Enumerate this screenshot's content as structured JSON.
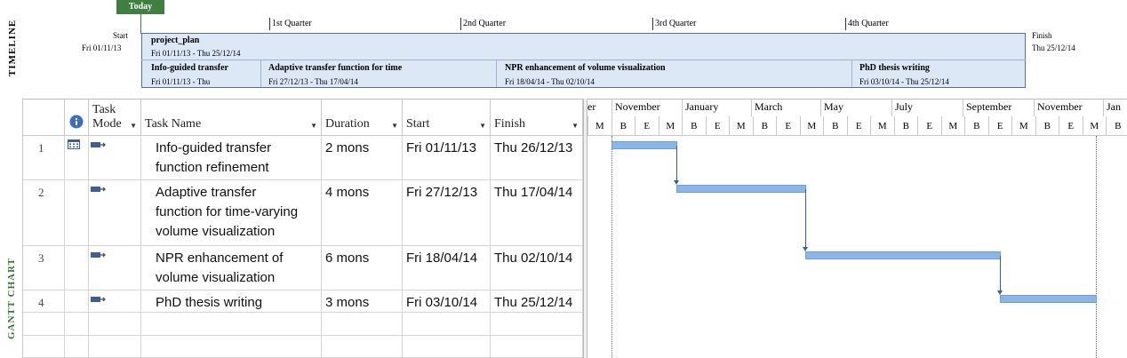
{
  "timeline": {
    "label": "TIMELINE",
    "today": "Today",
    "start_label": "Start",
    "start_date": "Fri 01/11/13",
    "finish_label": "Finish",
    "finish_date": "Thu 25/12/14",
    "quarters": [
      "1st Quarter",
      "2nd Quarter",
      "3rd Quarter",
      "4th Quarter"
    ],
    "summary": {
      "name": "project_plan",
      "dates": "Fri 01/11/13 - Thu 25/12/14"
    },
    "segments": [
      {
        "name": "Info-guided transfer",
        "dates": "Fri 01/11/13 - Thu"
      },
      {
        "name": "Adaptive transfer function for time",
        "dates": "Fri 27/12/13 - Thu 17/04/14"
      },
      {
        "name": "NPR enhancement of volume visualization",
        "dates": "Fri 18/04/14 - Thu 02/10/14"
      },
      {
        "name": "PhD thesis writing",
        "dates": "Fri 03/10/14 - Thu 25/12/14"
      }
    ]
  },
  "gantt": {
    "label": "GANTT CHART",
    "info_icon": "info-icon",
    "columns": {
      "mode_line1": "Task",
      "mode_line2": "Mode",
      "name": "Task Name",
      "duration": "Duration",
      "start": "Start",
      "finish": "Finish"
    },
    "tasks": [
      {
        "id": "1",
        "name_lines": [
          "Info-guided transfer",
          "function refinement"
        ],
        "duration": "2 mons",
        "start": "Fri 01/11/13",
        "finish": "Thu 26/12/13"
      },
      {
        "id": "2",
        "name_lines": [
          "Adaptive transfer",
          "function for time-varying",
          "volume visualization"
        ],
        "duration": "4 mons",
        "start": "Fri 27/12/13",
        "finish": "Thu 17/04/14"
      },
      {
        "id": "3",
        "name_lines": [
          "NPR enhancement of",
          "volume visualization"
        ],
        "duration": "6 mons",
        "start": "Fri 18/04/14",
        "finish": "Thu 02/10/14"
      },
      {
        "id": "4",
        "name_lines": [
          "PhD thesis writing"
        ],
        "duration": "3 mons",
        "start": "Fri 03/10/14",
        "finish": "Thu 25/12/14"
      }
    ],
    "months": [
      "er",
      "November",
      "January",
      "March",
      "May",
      "July",
      "September",
      "November",
      "Jan"
    ],
    "subcols": [
      "M",
      "B",
      "E",
      "M",
      "B",
      "E",
      "M",
      "B",
      "E",
      "M",
      "B",
      "E",
      "M",
      "B",
      "E",
      "M",
      "B",
      "E",
      "M",
      "B",
      "E",
      "M",
      "B",
      "E",
      "M",
      "B"
    ]
  }
}
